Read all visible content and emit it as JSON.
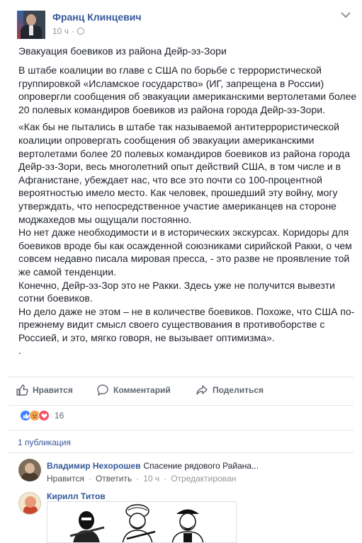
{
  "post": {
    "author": "Франц Клинцевич",
    "time": "10 ч",
    "dot": "·",
    "title": "Эвакуация боевиков из района Дейр-эз-Зори",
    "paragraphs": [
      "В штабе коалиции во главе с США по борьбе с террористической группировкой «Исламское государство» (ИГ, запрещена в России) опровергли сообщения об эвакуации американскими вертолетами более 20 полевых командиров боевиков из района города Дейр-эз-Зори.",
      "«Как бы не пытались в штабе так называемой антитеррористической коалиции опровергать сообщения об эвакуации американскими вертолетами более 20 полевых командиров боевиков из района города Дейр-эз-Зори, весь многолетний опыт действий США, в том числе и в Афганистане, убеждает нас, что все это почти со 100-процентной вероятностью имело место. Как человек, прошедший эту войну, могу утверждать, что непосредственное участие американцев на стороне моджахедов мы ощущали постоянно.",
      "Но нет даже необходимости и в исторических экскурсах. Коридоры для боевиков вроде бы как осажденной союзниками сирийской Ракки, о чем совсем недавно писала мировая пресса, - это разве не проявление той же самой тенденции.",
      "Конечно, Дейр-эз-Зор это не Ракки. Здесь уже не получится вывезти сотни боевиков.",
      "Но дело даже не этом – не в количестве боевиков. Похоже, что США по-прежнему видит смысл своего существования в противоборстве с Россией, и это, мягко говоря, не вызывает оптимизма».",
      "."
    ]
  },
  "actions": {
    "like": "Нравится",
    "comment": "Комментарий",
    "share": "Поделиться"
  },
  "reactions": {
    "count": "16",
    "types": [
      "like",
      "angry",
      "love"
    ]
  },
  "shares": "1 публикация",
  "comments": [
    {
      "author": "Владимир Нехорошев",
      "text": "Спасение рядового Райана...",
      "like": "Нравится",
      "reply": "Ответить",
      "time": "10 ч",
      "edited": "Отредактирован",
      "sep": "·"
    },
    {
      "author": "Кирилл Титов"
    }
  ],
  "colors": {
    "link": "#365899",
    "text": "#1d2129",
    "muted": "#90949c",
    "like_reaction": "#4080ff",
    "angry_reaction": "#f0a34e",
    "love_reaction": "#f25268"
  }
}
